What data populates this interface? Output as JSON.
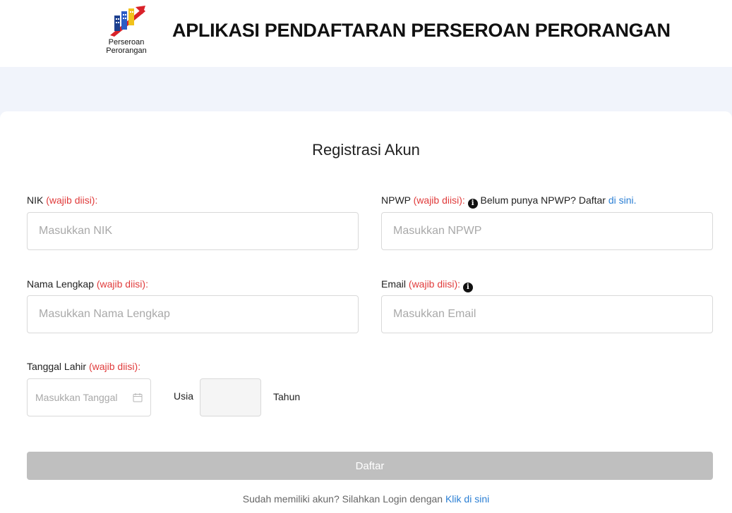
{
  "header": {
    "logo_text_line1": "Perseroan",
    "logo_text_line2": "Perorangan",
    "title": "APLIKASI PENDAFTARAN PERSEROAN PERORANGAN"
  },
  "form": {
    "title": "Registrasi Akun",
    "required_text": "(wajib diisi):",
    "nik": {
      "label": "NIK",
      "placeholder": "Masukkan NIK"
    },
    "npwp": {
      "label": "NPWP",
      "hint": "Belum punya NPWP? Daftar",
      "hint_link": "di sini.",
      "placeholder": "Masukkan NPWP"
    },
    "nama": {
      "label": "Nama Lengkap",
      "placeholder": "Masukkan Nama Lengkap"
    },
    "email": {
      "label": "Email",
      "placeholder": "Masukkan Email"
    },
    "tanggal": {
      "label": "Tanggal Lahir",
      "placeholder": "Masukkan Tanggal"
    },
    "usia_label": "Usia",
    "tahun_label": "Tahun",
    "submit_label": "Daftar",
    "login_text": "Sudah memiliki akun? Silahkan Login dengan",
    "login_link": "Klik di sini"
  },
  "icons": {
    "info": "info-icon",
    "calendar": "calendar-icon",
    "logo": "building-logo-icon"
  },
  "colors": {
    "required": "#e03b3b",
    "link": "#2b7fd4",
    "button_disabled": "#bfbfbf",
    "band": "#f1f4fb"
  }
}
